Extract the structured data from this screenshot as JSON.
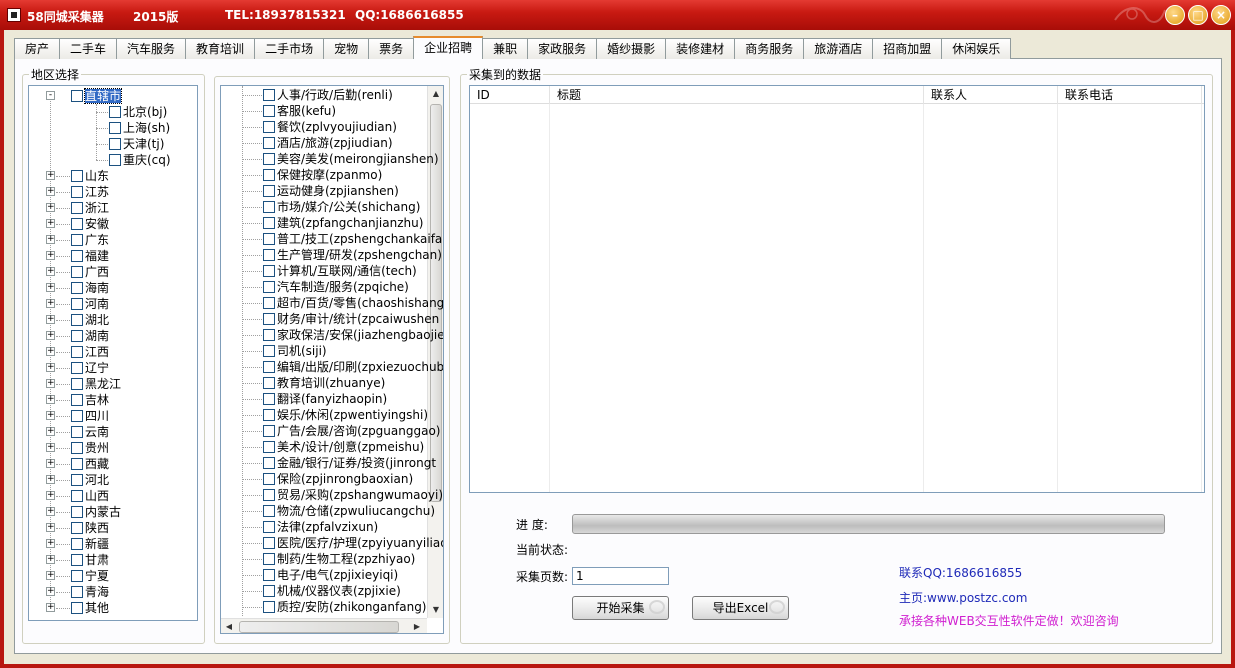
{
  "window": {
    "app_name": "58同城采集器",
    "version": "2015版",
    "tel": "TEL:18937815321",
    "qq": "QQ:1686616855"
  },
  "tabs": [
    "房产",
    "二手车",
    "汽车服务",
    "教育培训",
    "二手市场",
    "宠物",
    "票务",
    "企业招聘",
    "兼职",
    "家政服务",
    "婚纱摄影",
    "装修建材",
    "商务服务",
    "旅游酒店",
    "招商加盟",
    "休闲娱乐"
  ],
  "active_tab": "企业招聘",
  "region": {
    "legend": "地区选择",
    "root": "直辖市",
    "municipalities": [
      "北京(bj)",
      "上海(sh)",
      "天津(tj)",
      "重庆(cq)"
    ],
    "provinces": [
      "山东",
      "江苏",
      "浙江",
      "安徽",
      "广东",
      "福建",
      "广西",
      "海南",
      "河南",
      "湖北",
      "湖南",
      "江西",
      "辽宁",
      "黑龙江",
      "吉林",
      "四川",
      "云南",
      "贵州",
      "西藏",
      "河北",
      "山西",
      "内蒙古",
      "陕西",
      "新疆",
      "甘肃",
      "宁夏",
      "青海",
      "其他"
    ]
  },
  "categories": [
    "人事/行政/后勤(renli)",
    "客服(kefu)",
    "餐饮(zplvyoujiudian)",
    "酒店/旅游(zpjiudian)",
    "美容/美发(meirongjianshen)",
    "保健按摩(zpanmo)",
    "运动健身(zpjianshen)",
    "市场/媒介/公关(shichang)",
    "建筑(zpfangchanjianzhu)",
    "普工/技工(zpshengchankaifa)",
    "生产管理/研发(zpshengchan)",
    "计算机/互联网/通信(tech)",
    "汽车制造/服务(zpqiche)",
    "超市/百货/零售(chaoshishang",
    "财务/审计/统计(zpcaiwushen",
    "家政保洁/安保(jiazhengbaojie",
    "司机(siji)",
    "编辑/出版/印刷(zpxiezuochub",
    "教育培训(zhuanye)",
    "翻译(fanyizhaopin)",
    "娱乐/休闲(zpwentiyingshi)",
    "广告/会展/咨询(zpguanggao)",
    "美术/设计/创意(zpmeishu)",
    "金融/银行/证券/投资(jinrongt",
    "保险(zpjinrongbaoxian)",
    "贸易/采购(zpshangwumaoyi)",
    "物流/仓储(zpwuliucangchu)",
    "法律(zpfalvzixun)",
    "医院/医疗/护理(zpyiyuanyiliao",
    "制药/生物工程(zpzhiyao)",
    "电子/电气(zpjixieyiqi)",
    "机械/仪器仪表(zpjixie)",
    "质控/安防(zhikonganfang)"
  ],
  "data": {
    "legend": "采集到的数据",
    "columns": [
      "ID",
      "标题",
      "联系人",
      "联系电话"
    ]
  },
  "controls": {
    "progress_label": "进  度:",
    "progress": 0,
    "status_label": "当前状态:",
    "status_value": "",
    "pages_label": "采集页数:",
    "pages_value": "1",
    "start_button": "开始采集",
    "export_button": "导出Excel"
  },
  "contact": {
    "qq": "联系QQ:1686616855",
    "homepage": "主页:www.postzc.com",
    "ad": "承接各种WEB交互性软件定做！欢迎咨询"
  },
  "colors": {
    "titlebar": "#c91a12",
    "contact_blue": "#1f2ab8",
    "ad_magenta": "#d020d0"
  }
}
